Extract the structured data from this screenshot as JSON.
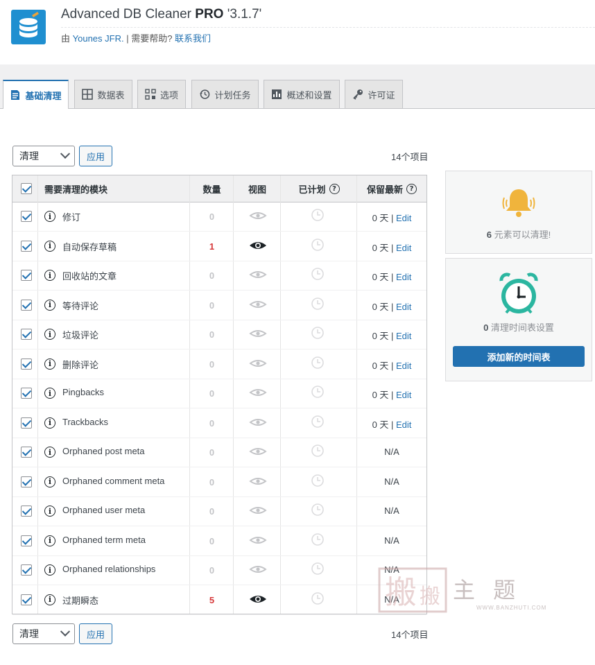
{
  "header": {
    "title_main": "Advanced DB Cleaner ",
    "title_pro": "PRO",
    "title_version": " '3.1.7'",
    "byline_prefix": "由 ",
    "author": "Younes JFR.",
    "separator": " | ",
    "help_text": "需要帮助? ",
    "contact_link": "联系我们"
  },
  "tabs": [
    {
      "label": "基础清理",
      "icon": "document-lines-icon"
    },
    {
      "label": "数据表",
      "icon": "table-grid-icon"
    },
    {
      "label": "选项",
      "icon": "options-grid-icon"
    },
    {
      "label": "计划任务",
      "icon": "history-clock-icon"
    },
    {
      "label": "概述和设置",
      "icon": "chart-settings-icon"
    },
    {
      "label": "许可证",
      "icon": "key-icon"
    }
  ],
  "toolbar_top": {
    "action_select": "清理",
    "apply_label": "应用",
    "items_count": "14个项目"
  },
  "toolbar_bottom": {
    "action_select": "清理",
    "apply_label": "应用",
    "items_count": "14个项目"
  },
  "table": {
    "columns": {
      "module": "需要清理的模块",
      "count": "数量",
      "view": "视图",
      "scheduled": "已计划",
      "keep_last": "保留最新"
    },
    "rows": [
      {
        "name": "修订",
        "count": "0",
        "keep": "0 天",
        "edit": "Edit"
      },
      {
        "name": "自动保存草稿",
        "count": "1",
        "keep": "0 天",
        "edit": "Edit"
      },
      {
        "name": "回收站的文章",
        "count": "0",
        "keep": "0 天",
        "edit": "Edit"
      },
      {
        "name": "等待评论",
        "count": "0",
        "keep": "0 天",
        "edit": "Edit"
      },
      {
        "name": "垃圾评论",
        "count": "0",
        "keep": "0 天",
        "edit": "Edit"
      },
      {
        "name": "删除评论",
        "count": "0",
        "keep": "0 天",
        "edit": "Edit"
      },
      {
        "name": "Pingbacks",
        "count": "0",
        "keep": "0 天",
        "edit": "Edit"
      },
      {
        "name": "Trackbacks",
        "count": "0",
        "keep": "0 天",
        "edit": "Edit"
      },
      {
        "name": "Orphaned post meta",
        "count": "0",
        "keep": "N/A",
        "edit": ""
      },
      {
        "name": "Orphaned comment meta",
        "count": "0",
        "keep": "N/A",
        "edit": ""
      },
      {
        "name": "Orphaned user meta",
        "count": "0",
        "keep": "N/A",
        "edit": ""
      },
      {
        "name": "Orphaned term meta",
        "count": "0",
        "keep": "N/A",
        "edit": ""
      },
      {
        "name": "Orphaned relationships",
        "count": "0",
        "keep": "N/A",
        "edit": ""
      },
      {
        "name": "过期瞬态",
        "count": "5",
        "keep": "N/A",
        "edit": ""
      }
    ]
  },
  "sidebar": {
    "cleanable_count": "6",
    "cleanable_text": " 元素可以清理!",
    "schedules_count": "0",
    "schedules_text": " 清理时间表设置",
    "add_schedule_label": "添加新的时间表"
  },
  "watermark": {
    "text": "主 题",
    "url": "WWW.BANZHUTI.COM"
  },
  "colors": {
    "accent": "#2271b1",
    "red": "#d63638",
    "bell": "#f0b43c",
    "clock": "#2bb6a0"
  }
}
